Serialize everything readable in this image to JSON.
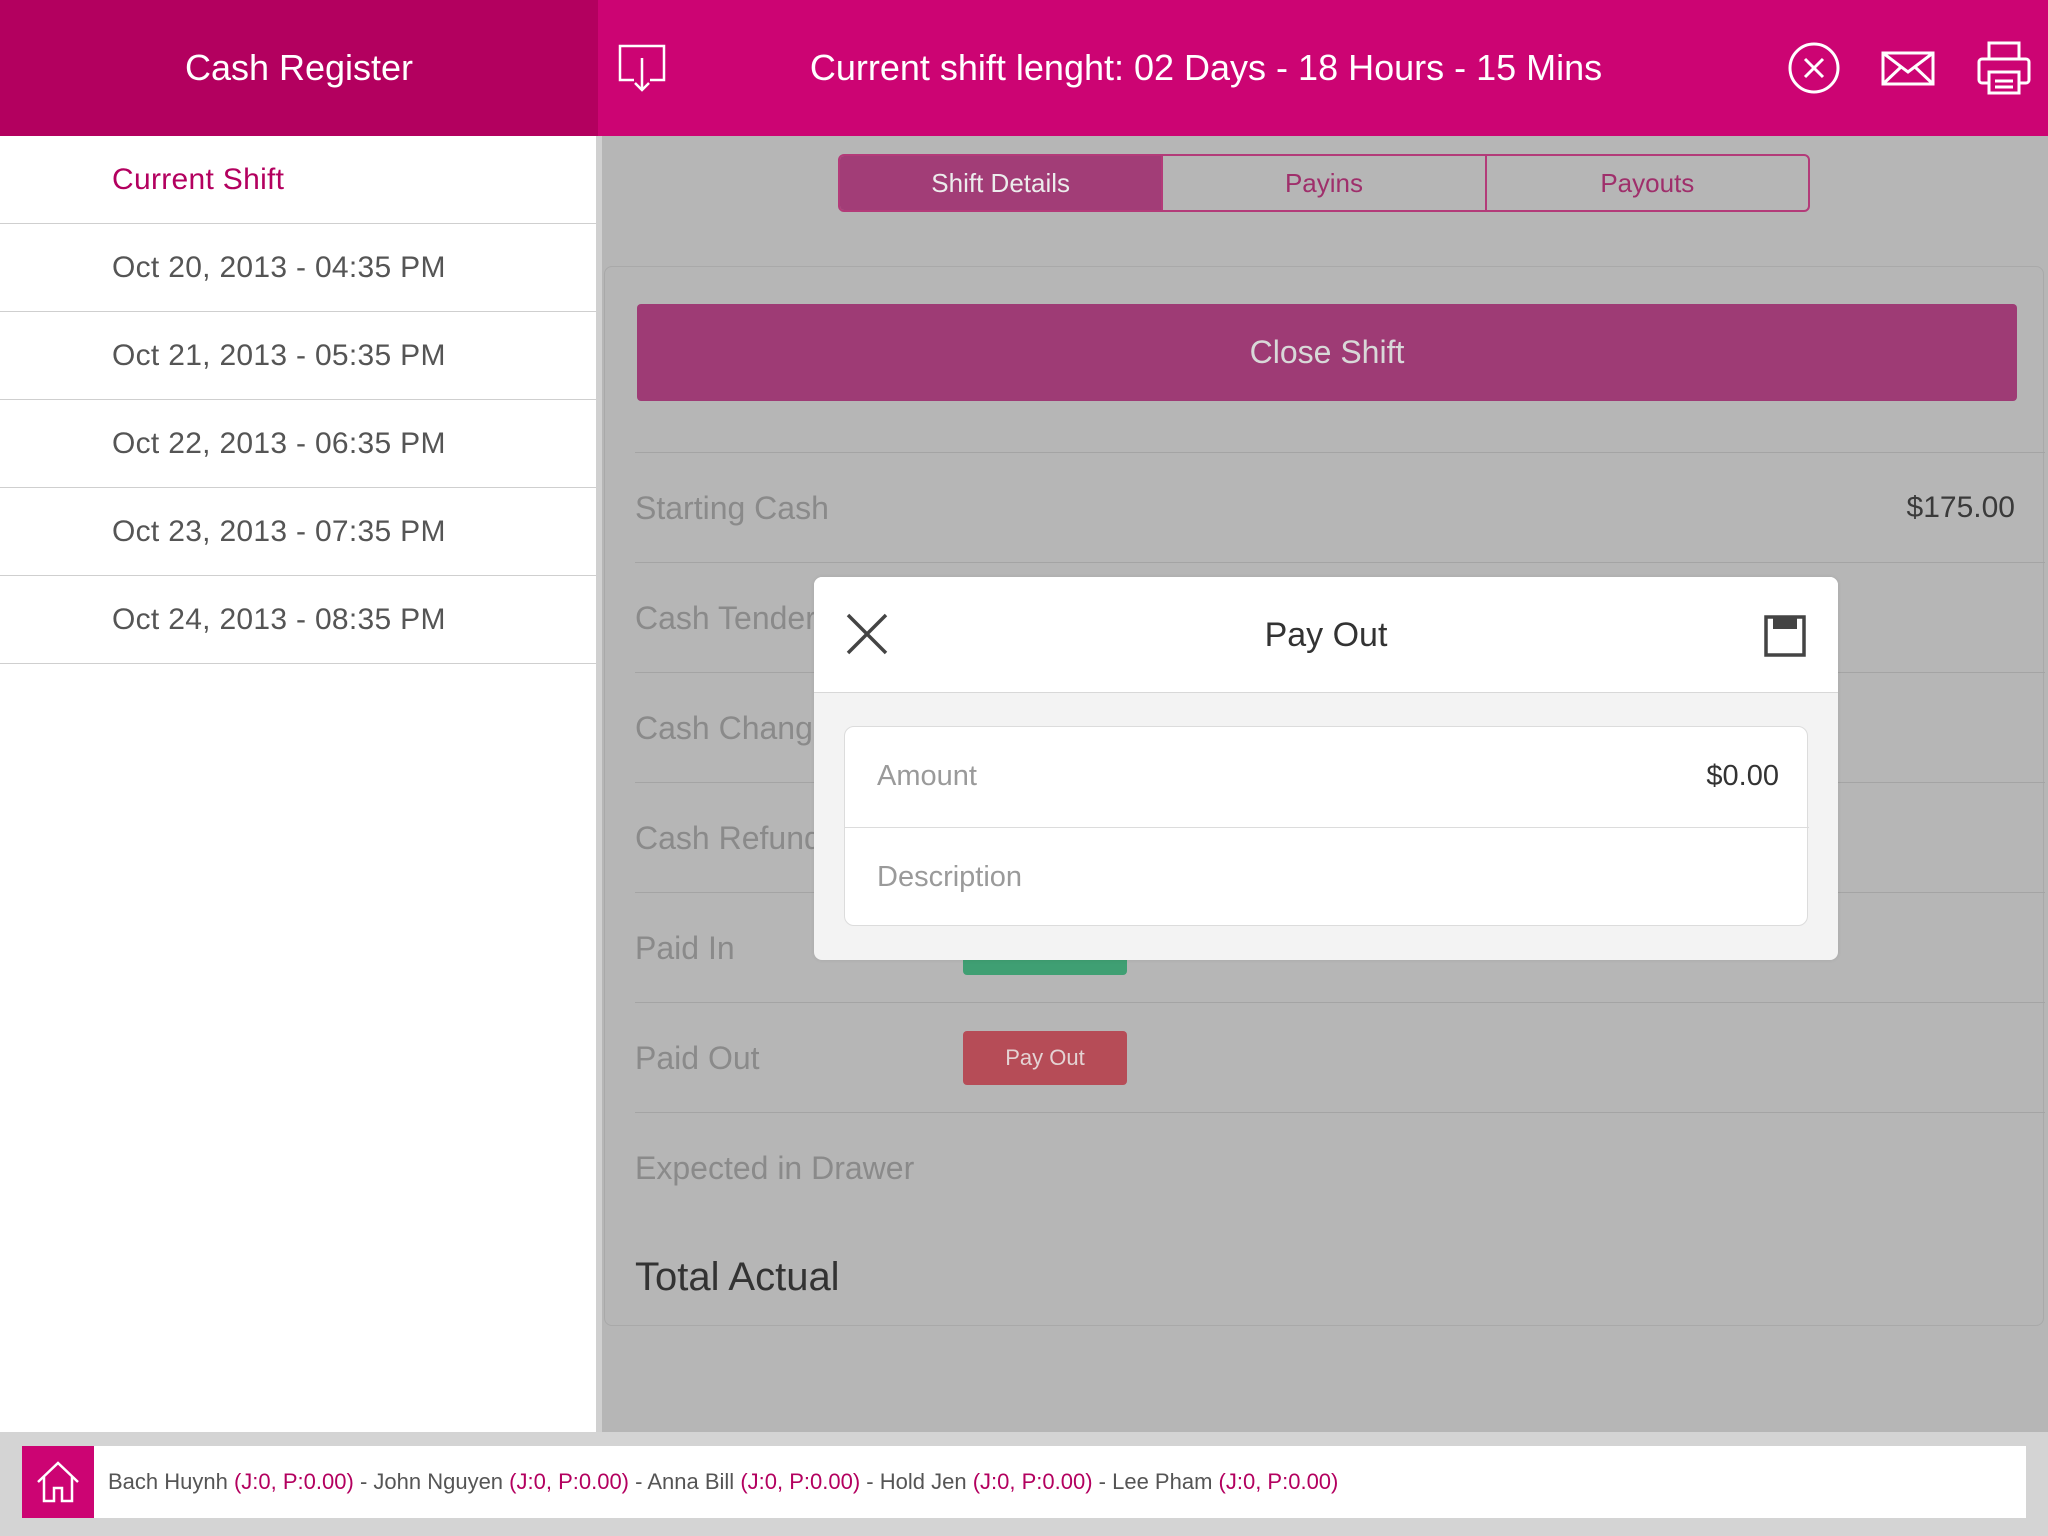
{
  "header": {
    "app_title": "Cash Register",
    "shift_length": "Current shift lenght:  02 Days - 18 Hours - 15 Mins",
    "icons": [
      "download-icon",
      "close-circle-icon",
      "mail-icon",
      "printer-icon"
    ]
  },
  "sidebar": {
    "items": [
      {
        "label": "Current Shift",
        "active": true
      },
      {
        "label": "Oct 20, 2013 - 04:35 PM"
      },
      {
        "label": "Oct 21, 2013 - 05:35 PM"
      },
      {
        "label": "Oct 22, 2013 - 06:35 PM"
      },
      {
        "label": "Oct 23, 2013 - 07:35 PM"
      },
      {
        "label": "Oct 24, 2013 - 08:35 PM"
      }
    ]
  },
  "tabs": [
    {
      "label": "Shift Details",
      "active": true
    },
    {
      "label": "Payins"
    },
    {
      "label": "Payouts"
    }
  ],
  "main": {
    "close_shift_label": "Close Shift",
    "rows": [
      {
        "label": "Starting Cash",
        "value": "$175.00"
      },
      {
        "label": "Cash Tendere"
      },
      {
        "label": "Cash Change"
      },
      {
        "label": "Cash Refund"
      },
      {
        "label": "Paid In"
      },
      {
        "label": "Paid Out",
        "button": "Pay Out"
      },
      {
        "label": "Expected in Drawer"
      },
      {
        "label": "Total Actual"
      }
    ]
  },
  "modal": {
    "title": "Pay Out",
    "amount_label": "Amount",
    "amount_value": "$0.00",
    "description_placeholder": "Description"
  },
  "footer": {
    "staff": [
      {
        "name": "Bach Huynh",
        "stat": "(J:0, P:0.00)"
      },
      {
        "name": "John Nguyen",
        "stat": "(J:0, P:0.00)"
      },
      {
        "name": "Anna Bill",
        "stat": "(J:0, P:0.00)"
      },
      {
        "name": "Hold Jen",
        "stat": "(J:0, P:0.00)"
      },
      {
        "name": "Lee Pham",
        "stat": "(J:0, P:0.00)"
      }
    ],
    "separator": " - "
  },
  "colors": {
    "header_left": "#b3005f",
    "header_right": "#cc0473",
    "accent_dimmed": "#9e3b75",
    "payout_button": "#b64c57",
    "payin_button": "#3f9f73"
  }
}
